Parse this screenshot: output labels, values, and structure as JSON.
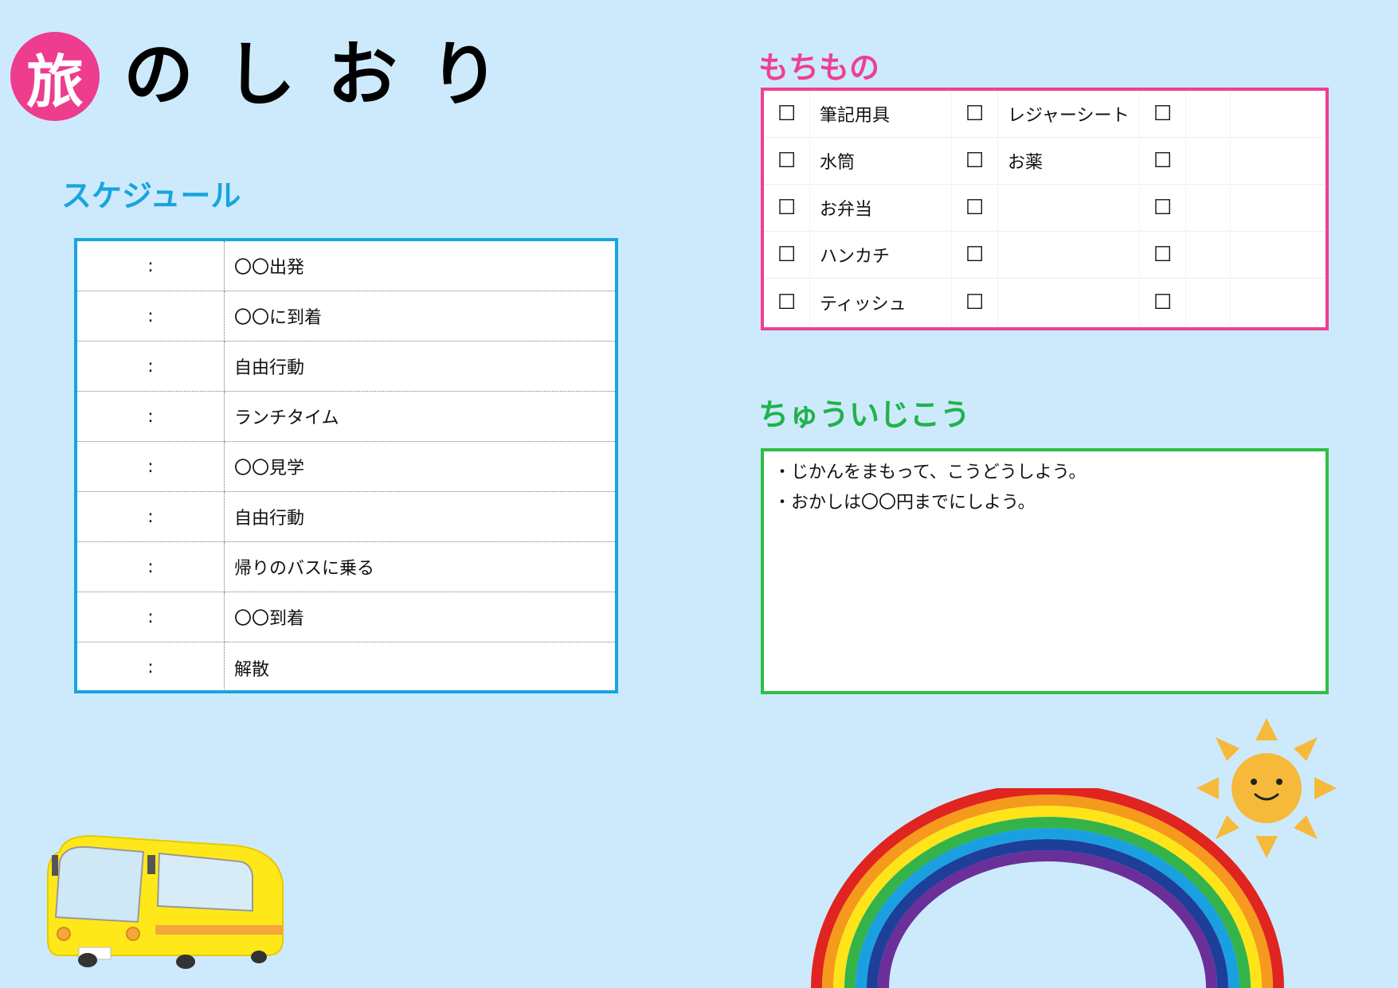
{
  "title": {
    "badge": "旅",
    "rest": "のしおり",
    "badge_color": "#ee3c8e"
  },
  "schedule": {
    "heading": "スケジュール",
    "rows": [
      {
        "time": ":",
        "activity": "〇〇出発"
      },
      {
        "time": ":",
        "activity": "〇〇に到着"
      },
      {
        "time": ":",
        "activity": "自由行動"
      },
      {
        "time": ":",
        "activity": "ランチタイム"
      },
      {
        "time": ":",
        "activity": "〇〇見学"
      },
      {
        "time": ":",
        "activity": "自由行動"
      },
      {
        "time": ":",
        "activity": "帰りのバスに乗る"
      },
      {
        "time": ":",
        "activity": "〇〇到着"
      },
      {
        "time": ":",
        "activity": "解散"
      }
    ]
  },
  "belongings": {
    "heading": "もちもの",
    "checkbox_glyph": "☐",
    "rows": [
      [
        "筆記用具",
        "レジャーシート",
        ""
      ],
      [
        "水筒",
        "お薬",
        ""
      ],
      [
        "お弁当",
        "",
        ""
      ],
      [
        "ハンカチ",
        "",
        ""
      ],
      [
        "ティッシュ",
        "",
        ""
      ]
    ]
  },
  "notes": {
    "heading": "ちゅういじこう",
    "lines": [
      "・じかんをまもって、こうどうしよう。",
      "・おかしは〇〇円までにしよう。"
    ]
  },
  "colors": {
    "background": "#cdeafc",
    "schedule_accent": "#19a4e0",
    "belongings_accent": "#ef3f91",
    "notes_accent": "#2ebe45"
  },
  "illustrations": [
    "bus-icon",
    "rainbow-icon",
    "sun-icon"
  ]
}
